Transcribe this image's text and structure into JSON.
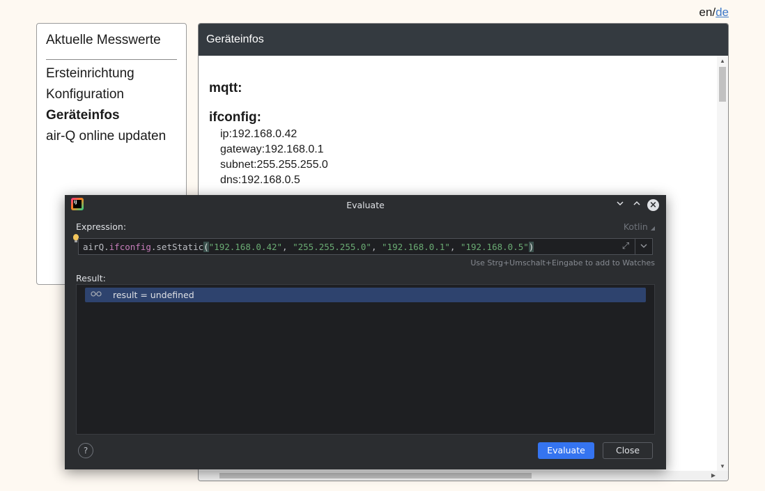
{
  "lang": {
    "current": "en",
    "sep": "/",
    "alt": "de"
  },
  "sidebar": {
    "heading": "Aktuelle Messwerte",
    "items": [
      {
        "label": "Ersteinrichtung"
      },
      {
        "label": "Konfiguration"
      },
      {
        "label": "Geräteinfos"
      },
      {
        "label": "air-Q online updaten"
      }
    ]
  },
  "panel": {
    "title": "Geräteinfos",
    "sections": {
      "mqtt": "mqtt:",
      "ifconfig": "ifconfig:"
    },
    "ifconfig": {
      "ip": "ip:192.168.0.42",
      "gateway": "gateway:192.168.0.1",
      "subnet": "subnet:255.255.255.0",
      "dns": "dns:192.168.0.5"
    }
  },
  "dialog": {
    "title": "Evaluate",
    "expression_label": "Expression:",
    "language": "Kotlin",
    "expression": {
      "var": "airQ",
      "dot1": ".",
      "prop": "ifconfig",
      "dot2": ".",
      "fn": "setStatic",
      "open": "(",
      "a1": "\"192.168.0.42\"",
      "c1": ", ",
      "a2": "\"255.255.255.0\"",
      "c2": ", ",
      "a3": "\"192.168.0.1\"",
      "c3": ", ",
      "a4": "\"192.168.0.5\"",
      "close": ")"
    },
    "hint": "Use Strg+Umschalt+Eingabe to add to Watches",
    "result_label": "Result:",
    "result": "result = undefined",
    "evaluate_button": "Evaluate",
    "close_button": "Close",
    "help": "?"
  },
  "colors": {
    "accent": "#3574f0",
    "panel_header": "#343a40",
    "dialog_bg": "#2b2d30",
    "selection": "#2e436e"
  }
}
